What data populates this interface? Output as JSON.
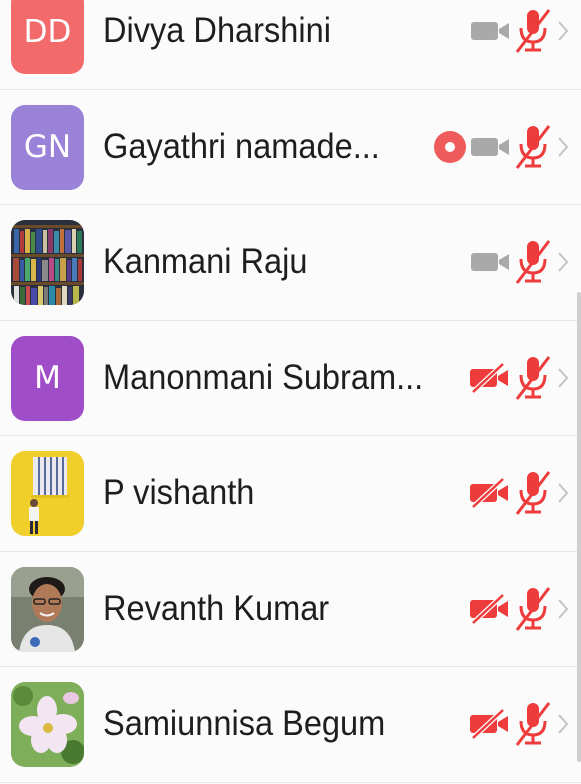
{
  "participants": [
    {
      "name": "Divya Dharshini",
      "initials": "DD",
      "avatar_color": "#f26a6a",
      "recording": false,
      "video_muted": false,
      "audio_muted": true
    },
    {
      "name": "Gayathri namade...",
      "initials": "GN",
      "avatar_color": "#9a82d8",
      "recording": true,
      "video_muted": false,
      "audio_muted": true
    },
    {
      "name": "Kanmani Raju",
      "initials": "",
      "avatar_color": "#3a4a6a",
      "recording": false,
      "video_muted": false,
      "audio_muted": true
    },
    {
      "name": "Manonmani Subram...",
      "initials": "M",
      "avatar_color": "#a04ec8",
      "recording": false,
      "video_muted": true,
      "audio_muted": true
    },
    {
      "name": "P vishanth",
      "initials": "",
      "avatar_color": "#f0cf2a",
      "recording": false,
      "video_muted": true,
      "audio_muted": true
    },
    {
      "name": "Revanth Kumar",
      "initials": "",
      "avatar_color": "#6a7060",
      "recording": false,
      "video_muted": true,
      "audio_muted": true
    },
    {
      "name": "Samiunnisa Begum",
      "initials": "",
      "avatar_color": "#7fae5a",
      "recording": false,
      "video_muted": true,
      "audio_muted": true
    }
  ],
  "icon_colors": {
    "active_gray": "#a9a9a9",
    "muted_red": "#ee3b3b",
    "chevron": "#c4c4c4",
    "record": "#ef5a5a"
  }
}
